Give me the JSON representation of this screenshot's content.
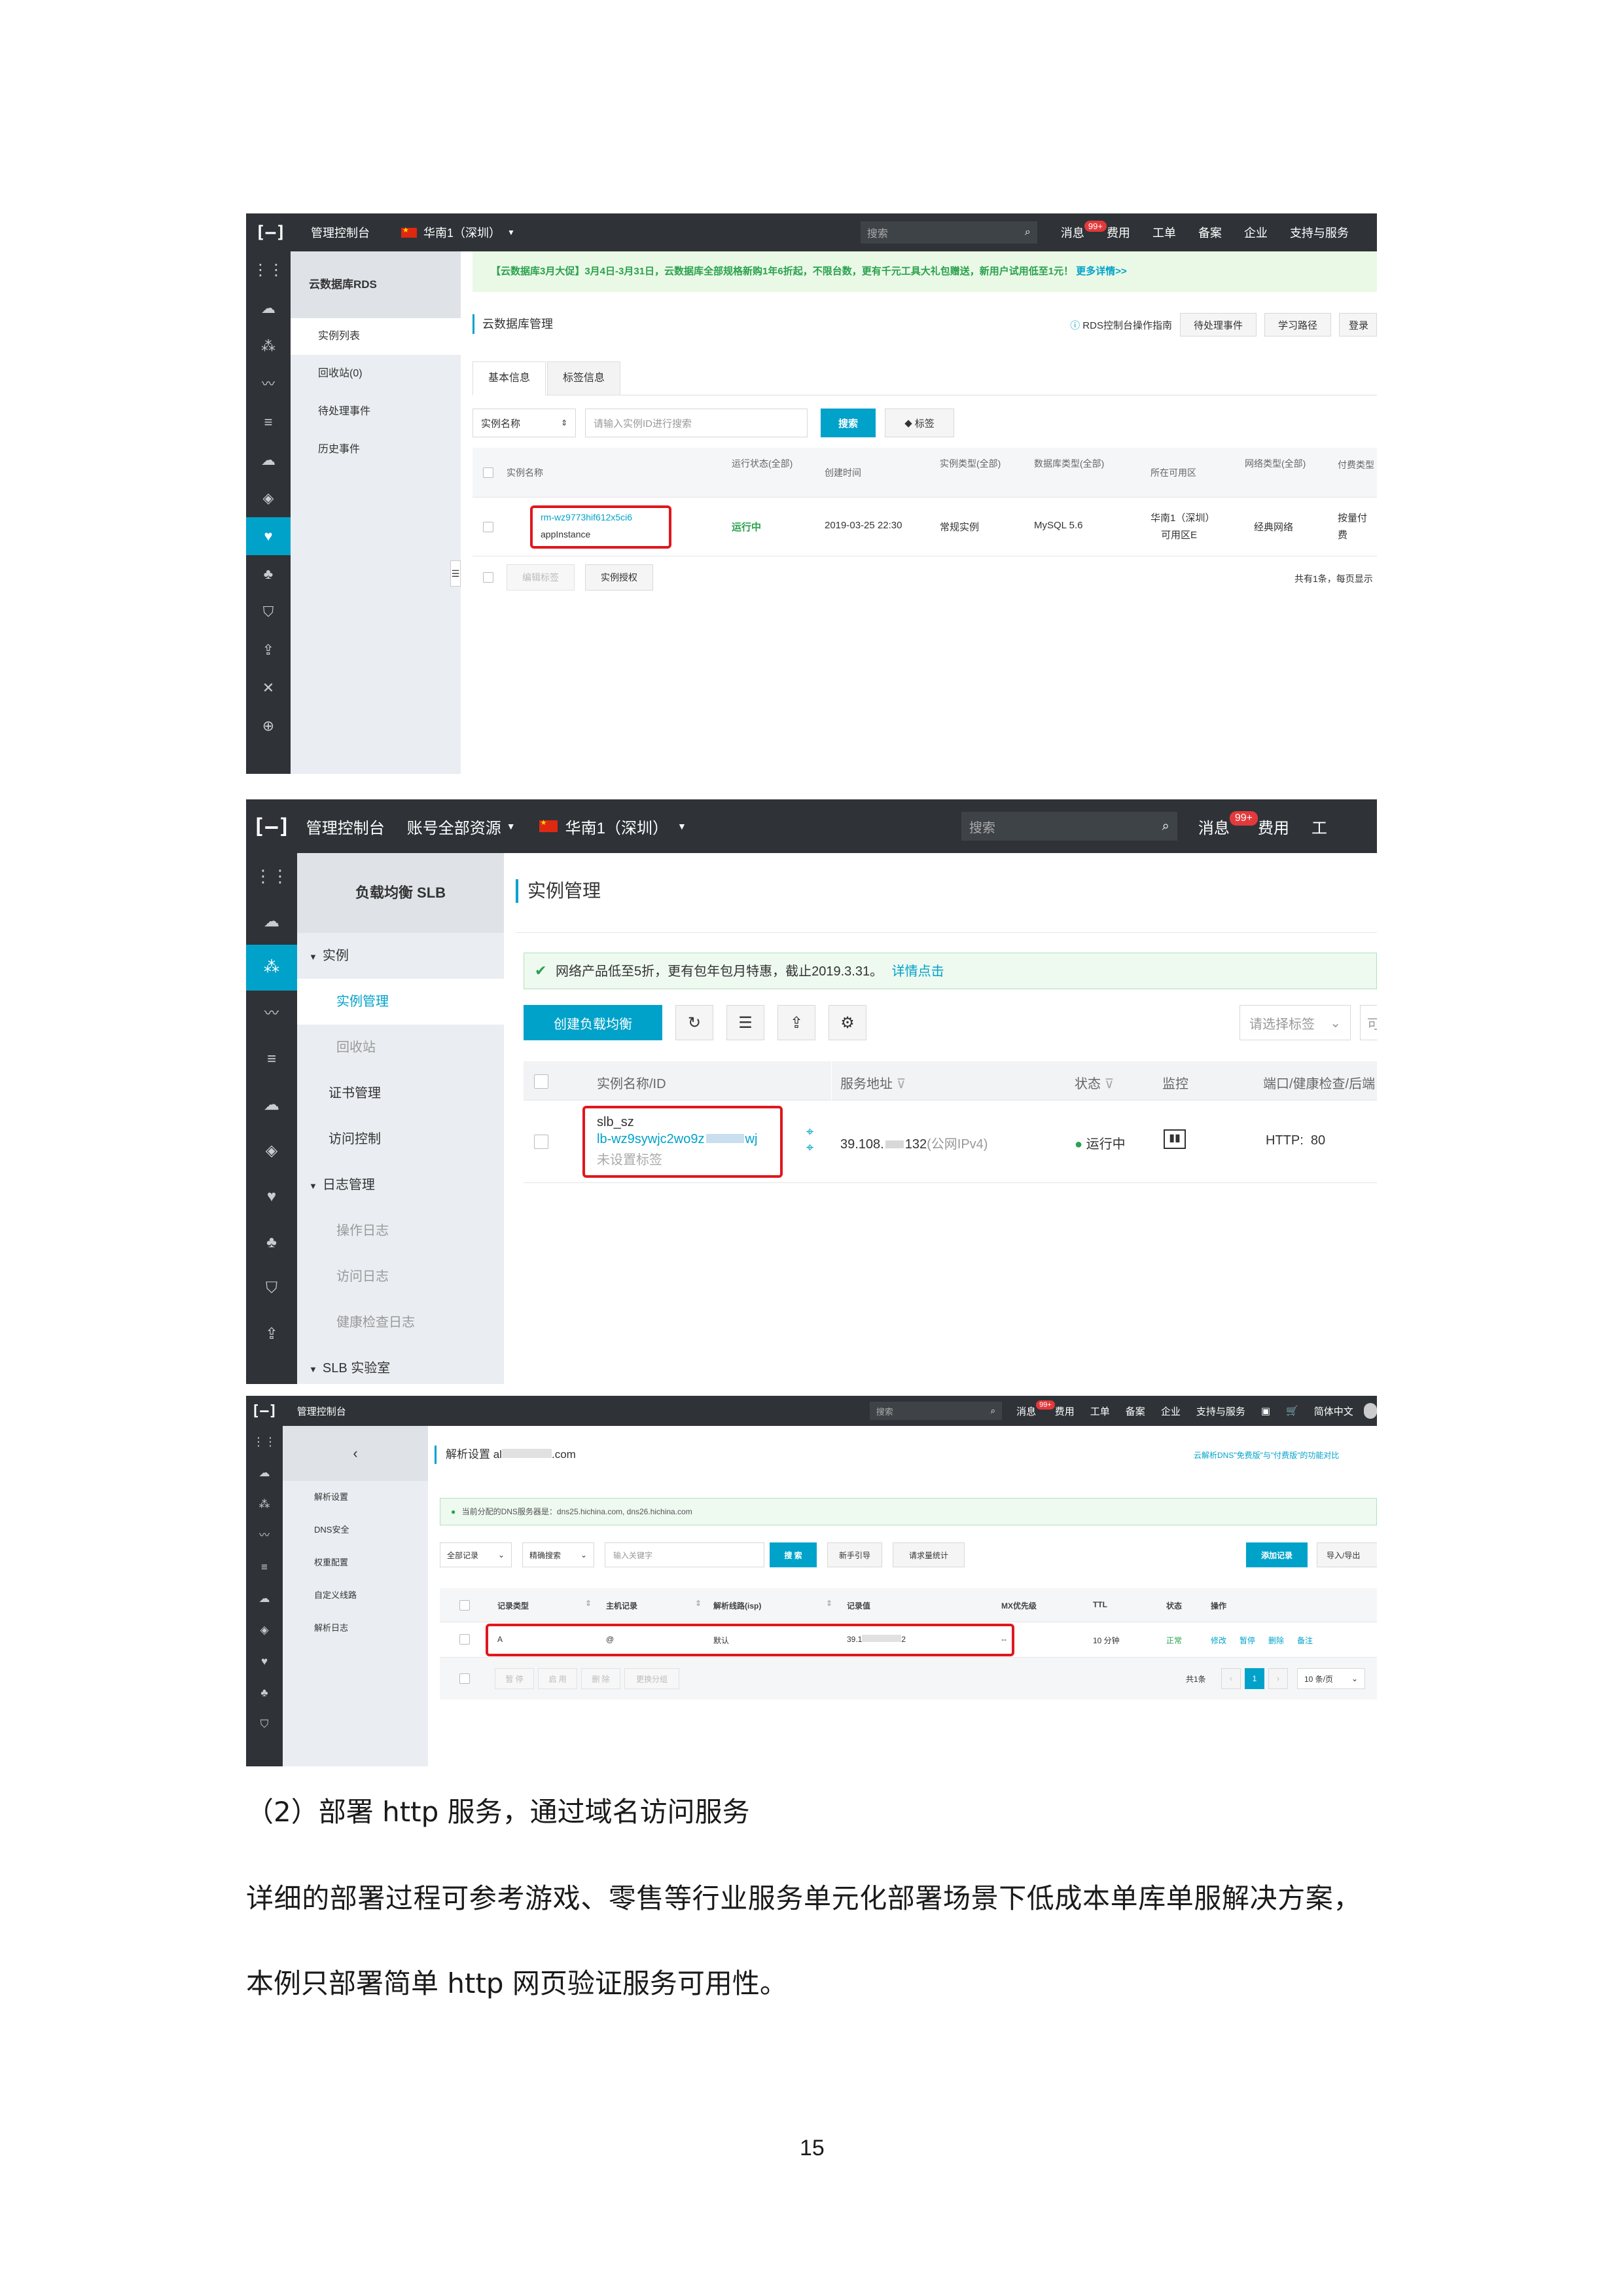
{
  "shot1": {
    "topbar": {
      "console": "管理控制台",
      "region": "华南1（深圳）",
      "search": "搜索",
      "messages": "消息",
      "badge": "99+",
      "items": [
        "费用",
        "工单",
        "备案",
        "企业",
        "支持与服务"
      ]
    },
    "product": "云数据库RDS",
    "nav": [
      "实例列表",
      "回收站(0)",
      "待处理事件",
      "历史事件"
    ],
    "promo": "【云数据库3月大促】3月4日-3月31日，云数据库全部规格新购1年6折起，不限台数，更有千元工具大礼包赠送，新用户试用低至1元！",
    "promo_link": "更多详情>>",
    "page_title": "云数据库管理",
    "guide": "RDS控制台操作指南",
    "header_buttons": [
      "待处理事件",
      "学习路径",
      "登录"
    ],
    "tabs": [
      "基本信息",
      "标签信息"
    ],
    "filter_select": "实例名称",
    "filter_placeholder": "请输入实例ID进行搜索",
    "search_btn": "搜索",
    "tag_btn": "标签",
    "columns": [
      "实例名称",
      "运行状态(全部)",
      "创建时间",
      "实例类型(全部)",
      "数据库类型(全部)",
      "所在可用区",
      "网络类型(全部)",
      "付费类型"
    ],
    "row": {
      "id": "rm-wz9773hif612x5ci6",
      "name": "appInstance",
      "status": "运行中",
      "created": "2019-03-25 22:30",
      "type": "常规实例",
      "db": "MySQL 5.6",
      "zone1": "华南1（深圳）",
      "zone2": "可用区E",
      "network": "经典网络",
      "pay1": "按量付",
      "pay2": "费"
    },
    "bottom_buttons": [
      "编辑标签",
      "实例授权"
    ],
    "pager": "共有1条，每页显示"
  },
  "shot2": {
    "topbar": {
      "console": "管理控制台",
      "resources": "账号全部资源",
      "region": "华南1（深圳）",
      "search": "搜索",
      "messages": "消息",
      "badge": "99+",
      "fee": "费用"
    },
    "product": "负载均衡 SLB",
    "nav": [
      {
        "label": "实例",
        "type": "group"
      },
      {
        "label": "实例管理",
        "type": "active"
      },
      {
        "label": "回收站",
        "type": "sub"
      },
      {
        "label": "证书管理",
        "type": "item"
      },
      {
        "label": "访问控制",
        "type": "item"
      },
      {
        "label": "日志管理",
        "type": "group"
      },
      {
        "label": "操作日志",
        "type": "sub"
      },
      {
        "label": "访问日志",
        "type": "sub"
      },
      {
        "label": "健康检查日志",
        "type": "sub"
      },
      {
        "label": "SLB 实验室",
        "type": "group"
      }
    ],
    "page_title": "实例管理",
    "notice": "网络产品低至5折，更有包年包月特惠，截止2019.3.31。",
    "notice_link": "详情点击",
    "create_btn": "创建负载均衡",
    "tag_select": "请选择标签",
    "more": "可",
    "columns": [
      "实例名称/ID",
      "服务地址",
      "状态",
      "监控",
      "端口/健康检查/后端"
    ],
    "row": {
      "name": "slb_sz",
      "id": "lb-wz9sywjc2wo9z",
      "id_tail": "wj",
      "tag": "未设置标签",
      "address": "39.108.",
      "address_tail": "132",
      "address_type": "(公网IPv4)",
      "status": "运行中",
      "port": "HTTP:  80"
    }
  },
  "shot3": {
    "topbar": {
      "console": "管理控制台",
      "search": "搜索",
      "messages": "消息",
      "badge": "99+",
      "items": [
        "费用",
        "工单",
        "备案",
        "企业",
        "支持与服务"
      ],
      "lang": "简体中文"
    },
    "nav": [
      "解析设置",
      "DNS安全",
      "权重配置",
      "自定义线路",
      "解析日志"
    ],
    "page_title_prefix": "解析设置 al",
    "page_title_suffix": ".com",
    "upgrade_link": "云解析DNS\"免费版\"与\"付费版\"的功能对比",
    "dns_notice": "当前分配的DNS服务器是：dns25.hichina.com, dns26.hichina.com",
    "filters": [
      "全部记录",
      "精确搜索"
    ],
    "keyword_placeholder": "输入关键字",
    "search_btn": "搜 索",
    "guide_btn": "新手引导",
    "stat_btn": "请求量统计",
    "add_btn": "添加记录",
    "import_btn": "导入/导出",
    "columns": [
      "记录类型",
      "主机记录",
      "解析线路(isp)",
      "记录值",
      "MX优先级",
      "TTL",
      "状态",
      "操作"
    ],
    "row": {
      "type": "A",
      "host": "@",
      "line": "默认",
      "value": "39.1",
      "value_tail": "2",
      "mx": "--",
      "ttl": "10 分钟",
      "status": "正常",
      "ops": [
        "修改",
        "暂停",
        "删除",
        "备注"
      ]
    },
    "bottom_buttons": [
      "暂 停",
      "启 用",
      "删 除",
      "更换分组"
    ],
    "total": "共1条",
    "page": "1",
    "per_page": "10 条/页"
  },
  "text": {
    "heading": "（2）部署 http 服务，通过域名访问服务",
    "line1": "详细的部署过程可参考游戏、零售等行业服务单元化部署场景下低成本单库单服解决方案，",
    "line2": "本例只部署简单 http 网页验证服务可用性。",
    "page_number": "15"
  }
}
